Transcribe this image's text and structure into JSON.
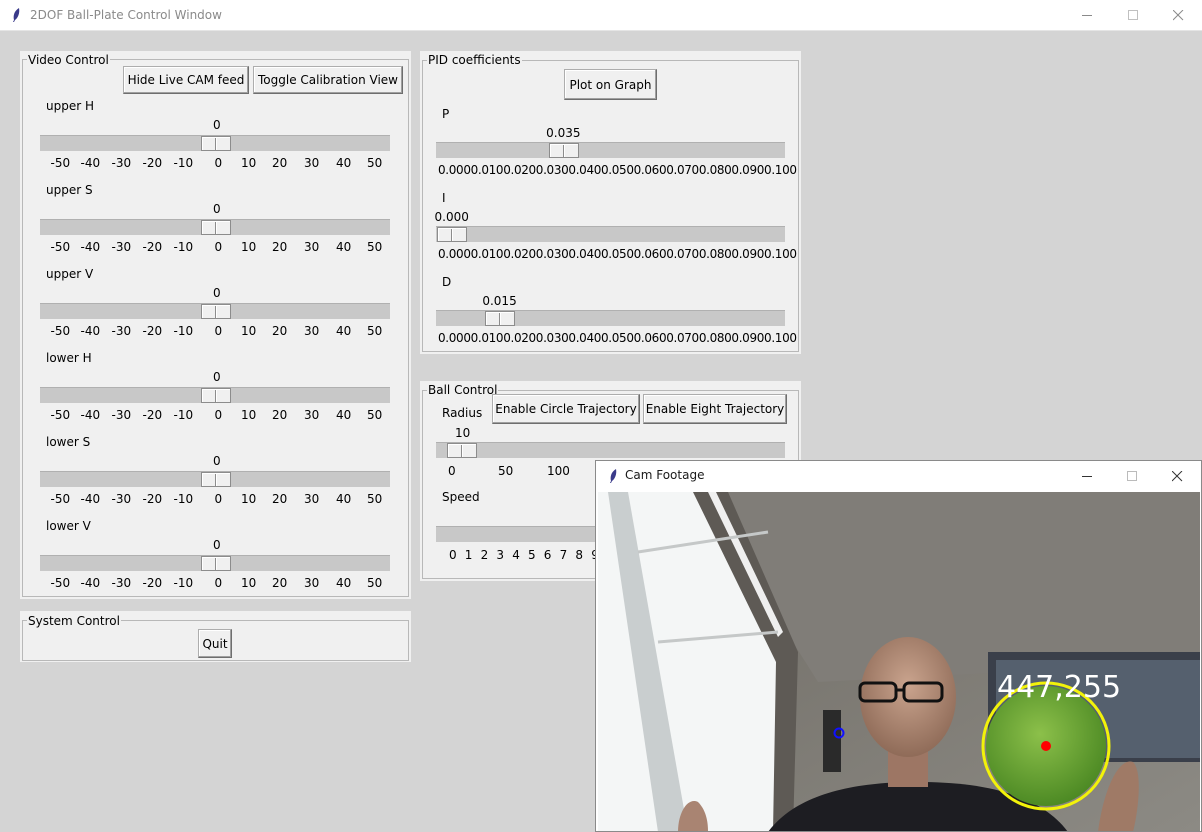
{
  "main_window": {
    "title": "2DOF Ball-Plate Control Window"
  },
  "video_control": {
    "frame_label": "Video Control",
    "hide_cam_button": "Hide Live CAM feed",
    "toggle_calibration_button": "Toggle Calibration View",
    "sliders": [
      {
        "label": "upper H",
        "value": "0",
        "min": -50,
        "max": 50
      },
      {
        "label": "upper S",
        "value": "0",
        "min": -50,
        "max": 50
      },
      {
        "label": "upper V",
        "value": "0",
        "min": -50,
        "max": 50
      },
      {
        "label": "lower H",
        "value": "0",
        "min": -50,
        "max": 50
      },
      {
        "label": "lower S",
        "value": "0",
        "min": -50,
        "max": 50
      },
      {
        "label": "lower V",
        "value": "0",
        "min": -50,
        "max": 50
      }
    ],
    "ticks": [
      "-50",
      "-40",
      "-30",
      "-20",
      "-10",
      "0",
      "10",
      "20",
      "30",
      "40",
      "50"
    ]
  },
  "system_control": {
    "frame_label": "System Control",
    "quit_button": "Quit"
  },
  "pid": {
    "frame_label": "PID coefficients",
    "plot_button": "Plot on Graph",
    "sliders": [
      {
        "label": "P",
        "value": "0.035",
        "numeric": 0.035
      },
      {
        "label": "I",
        "value": "0.000",
        "numeric": 0.0
      },
      {
        "label": "D",
        "value": "0.015",
        "numeric": 0.015
      }
    ],
    "ticks_text": "0.0000.0100.0200.0300.0400.0500.0600.0700.0800.0900.100"
  },
  "ball_control": {
    "frame_label": "Ball Control",
    "radius_label": "Radius",
    "circle_button": "Enable Circle Trajectory",
    "eight_button": "Enable Eight Trajectory",
    "radius_value": "10",
    "radius_ticks": [
      "0",
      "50",
      "100"
    ],
    "speed_label": "Speed",
    "speed_ticks": [
      "0",
      "1",
      "2",
      "3",
      "4",
      "5",
      "6",
      "7",
      "8",
      "9"
    ]
  },
  "cam_window": {
    "title": "Cam Footage",
    "coordinate_readout": "447,255"
  },
  "colors": {
    "ball_outline": "#f2f20a",
    "ball_center": "#ff0000",
    "target_marker": "#1010ff",
    "ball_fill": "#6aa532"
  }
}
